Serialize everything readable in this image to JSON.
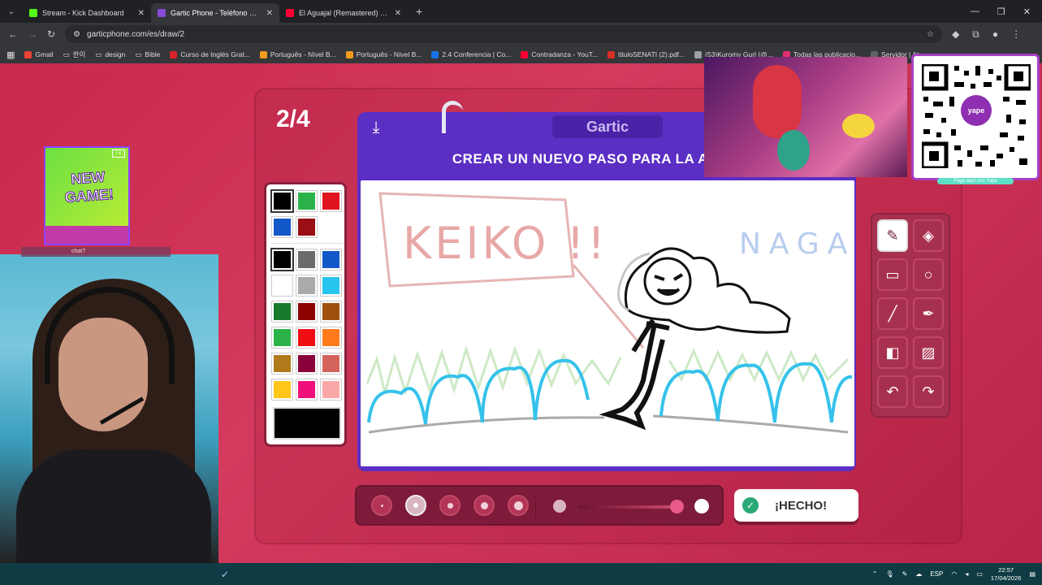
{
  "browser": {
    "tabs": [
      {
        "title": "Stream - Kick Dashboard",
        "color": "#53fc18",
        "active": false
      },
      {
        "title": "Gartic Phone - Teléfono Descon",
        "color": "#8a4bd6",
        "active": true
      },
      {
        "title": "El Aguajal (Remastered) - YouT",
        "color": "#ff0033",
        "active": false
      }
    ],
    "new_tab": "+",
    "url": "garticphone.com/es/draw/2",
    "bookmarks": [
      "Gmail",
      "한이",
      "design",
      "Bible",
      "Curso de Inglés Grat...",
      "Português - Nível B...",
      "Português - Nível B...",
      "2.4 Conferencia | Co...",
      "Contradanza - YouT...",
      "tituloSENATI (2).pdf...",
      "(53)Kuromy Gurl (@...",
      "Todas las publicacio...",
      "Servidor | At"
    ]
  },
  "game": {
    "round_counter": "2/4",
    "logo": "Gartic",
    "instruction": "CREAR UN NUEVO PASO PARA LA A",
    "done_button": "¡HECHO!",
    "palette_colors": [
      "#000000",
      "#2bb34a",
      "#e0141e",
      "#1358c9",
      "#9a0f14",
      "#000000",
      "#6b6b6b",
      "#1358c9",
      "#ffffff",
      "#aaaaaa",
      "#26c4ee",
      "#1a7a2c",
      "#8d0000",
      "#a0520c",
      "#2bb34a",
      "#f00d14",
      "#ff7b1c",
      "#b07a1a",
      "#8a003a",
      "#d4635c",
      "#ffc518",
      "#f0107a",
      "#f9a8a8"
    ],
    "selected_color": "#000000",
    "tools": [
      "pencil-icon",
      "eraser-icon",
      "rectangle-icon",
      "circle-icon",
      "line-icon",
      "eyedropper-icon",
      "fill-icon",
      "clear-icon",
      "undo-icon",
      "redo-icon"
    ],
    "brush_sizes": 5,
    "selected_brush": 2,
    "opacity_level": 0.85
  },
  "drawing": {
    "sign_text": "KEIKO !!",
    "corner_text": "NAGA"
  },
  "overlays": {
    "ad_text": "NEW GAME!",
    "ad_badge": "i x",
    "webcam_bar": "chat?",
    "qr_logo": "yape",
    "qr_caption": "Paga aquí con Yape"
  },
  "taskbar": {
    "language": "ESP",
    "time": "22:57",
    "date": "17/04/2026"
  }
}
